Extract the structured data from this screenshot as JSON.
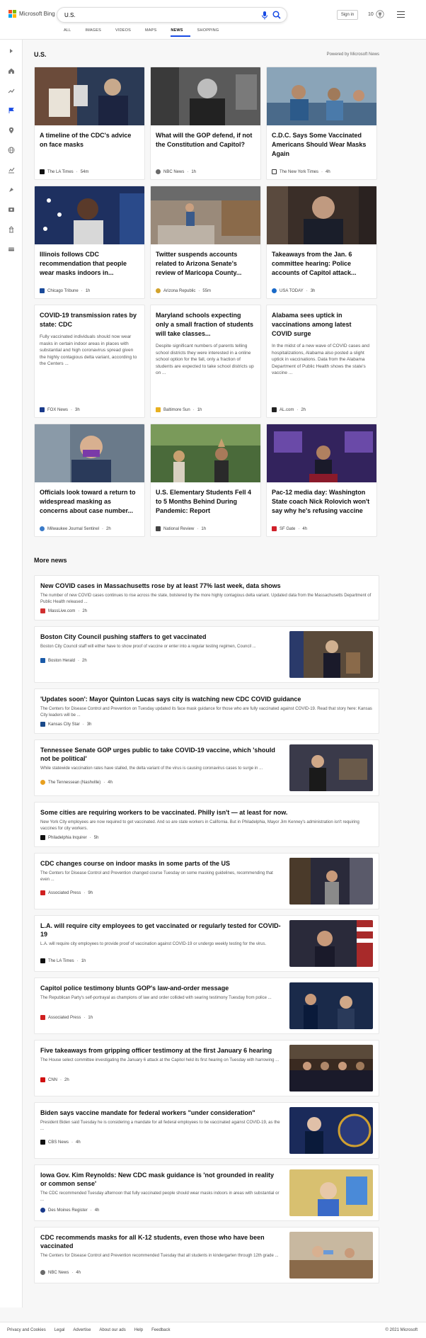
{
  "header": {
    "logo_text": "Microsoft Bing",
    "search_value": "U.S.",
    "signin_label": "Sign in",
    "reward_count": "10",
    "tabs": [
      {
        "label": "ALL"
      },
      {
        "label": "IMAGES"
      },
      {
        "label": "VIDEOS"
      },
      {
        "label": "MAPS"
      },
      {
        "label": "NEWS",
        "active": true
      },
      {
        "label": "SHOPPING"
      }
    ]
  },
  "rail": [
    "expand-icon",
    "home-icon",
    "trending-icon",
    "flag-icon",
    "location-icon",
    "globe-icon",
    "money-icon",
    "sports-icon",
    "movie-icon",
    "science-icon",
    "tech-icon"
  ],
  "section": {
    "title": "U.S.",
    "powered_by": "Powered by Microsoft News"
  },
  "cards": [
    {
      "title": "A timeline of the CDC's advice on face masks",
      "source": "The LA Times",
      "age": "54m",
      "desc": "",
      "has_image": true
    },
    {
      "title": "What will the GOP defend, if not the Constitution and Capitol?",
      "source": "NBC News",
      "age": "1h",
      "desc": "",
      "has_image": true
    },
    {
      "title": "C.D.C. Says Some Vaccinated Americans Should Wear Masks Again",
      "source": "The New York Times",
      "age": "4h",
      "desc": "",
      "has_image": true
    },
    {
      "title": "Illinois follows CDC recommendation that people wear masks indoors in...",
      "source": "Chicago Tribune",
      "age": "1h",
      "desc": "",
      "has_image": true
    },
    {
      "title": "Twitter suspends accounts related to Arizona Senate's review of Maricopa County...",
      "source": "Arizona Republic",
      "age": "55m",
      "desc": "",
      "has_image": true
    },
    {
      "title": "Takeaways from the Jan. 6 committee hearing: Police accounts of Capitol attack...",
      "source": "USA TODAY",
      "age": "3h",
      "desc": "",
      "has_image": true
    },
    {
      "title": "COVID-19 transmission rates by state: CDC",
      "source": "FOX News",
      "age": "3h",
      "desc": "Fully vaccinated individuals should now wear masks in certain indoor areas in places with substantial and high coronavirus spread given the highly contagious delta variant, according to the Centers ...",
      "has_image": false
    },
    {
      "title": "Maryland schools expecting only a small fraction of students will take classes...",
      "source": "Baltimore Sun",
      "age": "1h",
      "desc": "Despite significant numbers of parents telling school districts they were interested in a online school option for the fall, only a fraction of students are expected to take school districts up on ...",
      "has_image": false
    },
    {
      "title": "Alabama sees uptick in vaccinations among latest COVID surge",
      "source": "AL.com",
      "age": "2h",
      "desc": "In the midst of a new wave of COVID cases and hospitalizations, Alabama also posted a slight uptick in vaccinations. Data from the Alabama Department of Public Health shows the state's vaccine ...",
      "has_image": false
    },
    {
      "title": "Officials look toward a return to widespread masking as concerns about case number...",
      "source": "Milwaukee Journal Sentinel",
      "age": "2h",
      "desc": "",
      "has_image": true
    },
    {
      "title": "U.S. Elementary Students Fell 4 to 5 Months Behind During Pandemic: Report",
      "source": "National Review",
      "age": "1h",
      "desc": "",
      "has_image": true
    },
    {
      "title": "Pac-12 media day: Washington State coach Nick Rolovich won't say why he's refusing vaccine",
      "source": "SF Gate",
      "age": "4h",
      "desc": "",
      "has_image": true
    }
  ],
  "more_news_title": "More news",
  "more_news": [
    {
      "title": "New COVID cases in Massachusetts rose by at least 77% last week, data shows",
      "desc": "The number of new COVID cases continues to rise across the state, bolstered by the more highly contagious delta variant. Updated data from the Massachusetts Department of Public Health released ...",
      "source": "MassLive.com",
      "age": "2h",
      "has_thumb": false
    },
    {
      "title": "Boston City Council pushing staffers to get vaccinated",
      "desc": "Boston City Council staff will either have to show proof of vaccine or enter into a regular testing regimen, Council ...",
      "source": "Boston Herald",
      "age": "2h",
      "has_thumb": true
    },
    {
      "title": "'Updates soon': Mayor Quinton Lucas says city is watching new CDC COVID guidance",
      "desc": "The Centers for Disease Control and Prevention on Tuesday updated its face mask guidance for those who are fully vaccinated against COVID-19. Read that story here: Kansas City leaders will be ...",
      "source": "Kansas City Star",
      "age": "3h",
      "has_thumb": false
    },
    {
      "title": "Tennessee Senate GOP urges public to take COVID-19 vaccine, which 'should not be political'",
      "desc": "While statewide vaccination rates have stalled, the delta variant of the virus is causing coronavirus cases to surge in ...",
      "source": "The Tennessean (Nashville)",
      "age": "4h",
      "has_thumb": true
    },
    {
      "title": "Some cities are requiring workers to be vaccinated. Philly isn't — at least for now.",
      "desc": "New York City employees are now required to get vaccinated. And so are state workers in California. But in Philadelphia, Mayor Jim Kenney's administration isn't requiring vaccines for city workers.",
      "source": "Philadelphia Inquirer",
      "age": "5h",
      "has_thumb": false
    },
    {
      "title": "CDC changes course on indoor masks in some parts of the US",
      "desc": "The Centers for Disease Control and Prevention changed course Tuesday on some masking guidelines, recommending that even ...",
      "source": "Associated Press",
      "age": "9h",
      "has_thumb": true
    },
    {
      "title": "L.A. will require city employees to get vaccinated or regularly tested for COVID-19",
      "desc": "L.A. will require city employees to provide proof of vaccination against COVID-19 or undergo weekly testing for the virus.",
      "source": "The LA Times",
      "age": "1h",
      "has_thumb": true
    },
    {
      "title": "Capitol police testimony blunts GOP's law-and-order message",
      "desc": "The Republican Party's self-portrayal as champions of law and order collided with searing testimony Tuesday from police ...",
      "source": "Associated Press",
      "age": "1h",
      "has_thumb": true
    },
    {
      "title": "Five takeaways from gripping officer testimony at the first January 6 hearing",
      "desc": "The House select committee investigating the January 6 attack at the Capitol held its first hearing on Tuesday with harrowing ...",
      "source": "CNN",
      "age": "2h",
      "has_thumb": true
    },
    {
      "title": "Biden says vaccine mandate for federal workers \"under consideration\"",
      "desc": "President Biden said Tuesday he is considering a mandate for all federal employees to be vaccinated against COVID-19, as the ...",
      "source": "CBS News",
      "age": "4h",
      "has_thumb": true
    },
    {
      "title": "Iowa Gov. Kim Reynolds: New CDC mask guidance is 'not grounded in reality or common sense'",
      "desc": "The CDC recommended Tuesday afternoon that fully vaccinated people should wear masks indoors in areas with substantial or ...",
      "source": "Des Moines Register",
      "age": "4h",
      "has_thumb": true
    },
    {
      "title": "CDC recommends masks for all K-12 students, even those who have been vaccinated",
      "desc": "The Centers for Disease Control and Prevention recommended Tuesday that all students in kindergarten through 12th grade ...",
      "source": "NBC News",
      "age": "4h",
      "has_thumb": true
    }
  ],
  "footer": {
    "links": [
      "Privacy and Cookies",
      "Legal",
      "Advertise",
      "About our ads",
      "Help",
      "Feedback"
    ],
    "copyright": "© 2021 Microsoft"
  },
  "colors": {
    "accent": "#174ae4",
    "ms_red": "#f25022",
    "ms_green": "#7fba00",
    "ms_blue": "#00a4ef",
    "ms_yellow": "#ffb900"
  }
}
